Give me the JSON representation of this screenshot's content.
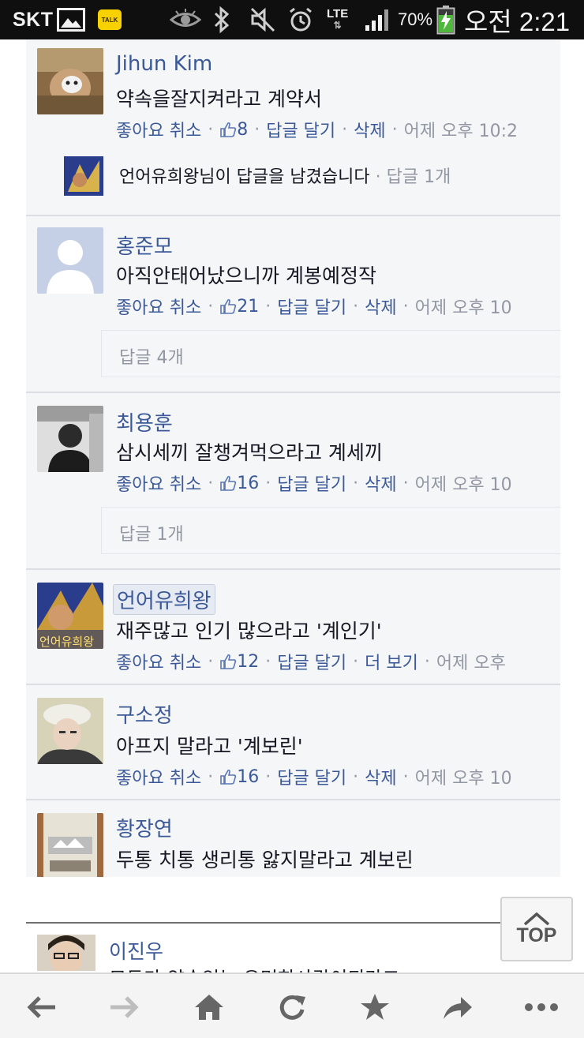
{
  "status_bar": {
    "carrier": "SKT",
    "network": "LTE",
    "battery": "70%",
    "time": "오전 2:21",
    "icons": [
      "gallery-icon",
      "kakaotalk-icon",
      "eye-icon",
      "bluetooth-icon",
      "mute-icon",
      "alarm-icon",
      "signal-icon",
      "battery-icon"
    ],
    "talk_label": "TALK"
  },
  "comments": [
    {
      "name": "Jihun Kim",
      "text": "약속을잘지켜라고 계약서",
      "action1": "좋아요 취소",
      "likes": "8",
      "action2": "답글 달기",
      "action3": "삭제",
      "time": "어제 오후 10:2",
      "reply": {
        "text": "언어유희왕님이 답글을 남겼습니다",
        "count": "답글 1개"
      }
    },
    {
      "name": "홍준모",
      "text": "아직안태어났으니까 계봉예정작",
      "action1": "좋아요 취소",
      "likes": "21",
      "action2": "답글 달기",
      "action3": "삭제",
      "time": "어제 오후 10",
      "reply_count": "답글 4개"
    },
    {
      "name": "최용훈",
      "text": "삼시세끼 잘챙겨먹으라고 계세끼",
      "action1": "좋아요 취소",
      "likes": "16",
      "action2": "답글 달기",
      "action3": "삭제",
      "time": "어제 오후 10",
      "reply_count": "답글 1개"
    },
    {
      "name": "언어유희왕",
      "text": "재주많고 인기 많으라고 '계인기'",
      "action1": "좋아요 취소",
      "likes": "12",
      "action2": "답글 달기",
      "action3": "더 보기",
      "time": "어제 오후",
      "avatar_caption": "언어유희왕"
    },
    {
      "name": "구소정",
      "text": "아프지 말라고 '계보린'",
      "action1": "좋아요 취소",
      "likes": "16",
      "action2": "답글 달기",
      "action3": "삭제",
      "time": "어제 오후 10"
    },
    {
      "name": "황장연",
      "text": "두통 치통 생리통 앓지말라고 계보린"
    }
  ],
  "next_comment": {
    "name": "이진우",
    "text": "모두가 약속있는 유명한사람이되라고"
  },
  "top_button": {
    "label": "TOP"
  },
  "nav": [
    "back-icon",
    "forward-icon",
    "home-icon",
    "reload-icon",
    "bookmark-star-icon",
    "share-icon",
    "more-icon"
  ],
  "colors": {
    "link": "#3b5998",
    "meta_gray": "#9197a3",
    "feed_bg": "#f5f6f8"
  }
}
